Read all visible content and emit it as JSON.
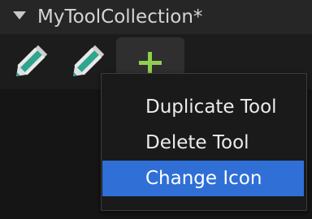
{
  "header": {
    "title": "MyToolCollection*",
    "collapse_icon": "triangle-down-icon"
  },
  "toolbar": {
    "tools": [
      {
        "icon": "pencil-icon"
      },
      {
        "icon": "pencil-icon"
      }
    ],
    "add_icon": "plus-icon",
    "add_color": "#8fcf4d",
    "pencil_accent": "#2fa58f"
  },
  "context_menu": {
    "items": [
      {
        "label": "Duplicate Tool"
      },
      {
        "label": "Delete Tool"
      },
      {
        "label": "Change Icon",
        "selected": true
      }
    ],
    "highlight_color": "#2f6fd6"
  }
}
